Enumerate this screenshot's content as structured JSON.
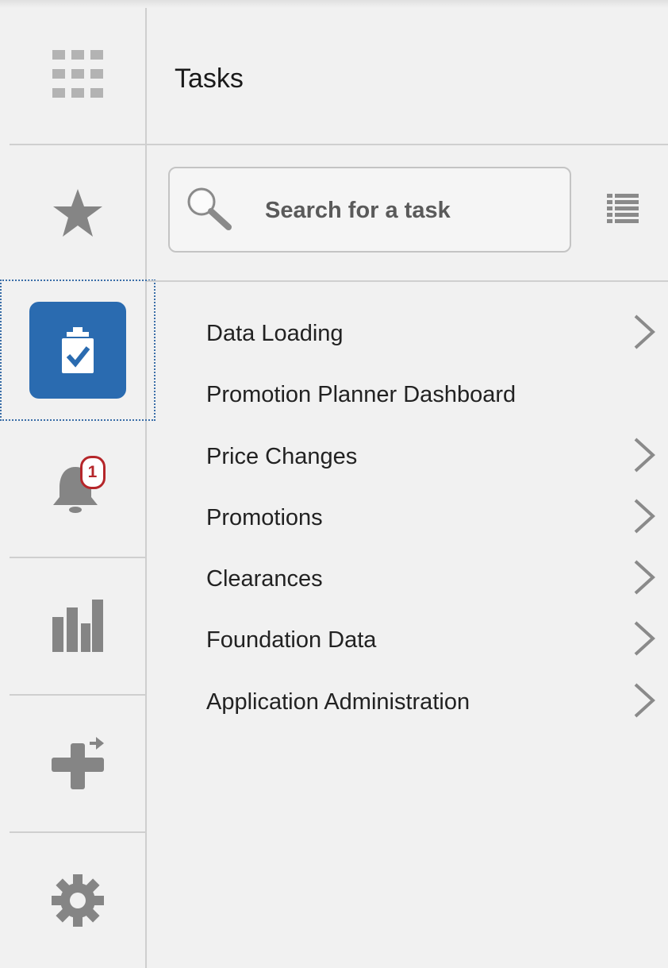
{
  "header": {
    "title": "Tasks"
  },
  "search": {
    "placeholder": "Search for a task"
  },
  "sidebar": {
    "items": [
      {
        "name": "navigator",
        "icon": "grid-icon"
      },
      {
        "name": "favorites",
        "icon": "star-icon"
      },
      {
        "name": "tasks",
        "icon": "clipboard-check-icon",
        "active": true
      },
      {
        "name": "notifications",
        "icon": "bell-icon",
        "badge": "1"
      },
      {
        "name": "reports",
        "icon": "bar-chart-icon"
      },
      {
        "name": "integration",
        "icon": "plus-arrow-icon"
      },
      {
        "name": "settings",
        "icon": "gear-icon"
      }
    ]
  },
  "tasks": [
    {
      "label": "Data Loading",
      "has_children": true
    },
    {
      "label": "Promotion Planner Dashboard",
      "has_children": false
    },
    {
      "label": "Price Changes",
      "has_children": true
    },
    {
      "label": "Promotions",
      "has_children": true
    },
    {
      "label": "Clearances",
      "has_children": true
    },
    {
      "label": "Foundation Data",
      "has_children": true
    },
    {
      "label": "Application Administration",
      "has_children": true
    }
  ],
  "colors": {
    "accent": "#2a6bb0",
    "badge": "#b5262a",
    "icon_gray": "#8a8a8a",
    "background": "#f1f1f1"
  }
}
